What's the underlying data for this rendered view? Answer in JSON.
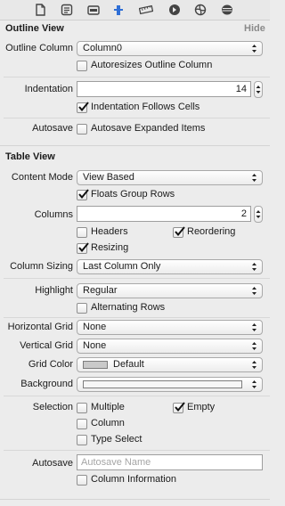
{
  "toolbar": {
    "icons": [
      "file-inspector-icon",
      "quick-help-icon",
      "identity-inspector-icon",
      "attributes-inspector-icon",
      "size-inspector-icon",
      "connections-inspector-icon",
      "bindings-inspector-icon",
      "view-effects-inspector-icon"
    ],
    "selected": "attributes-inspector-icon"
  },
  "outline_view": {
    "title": "Outline View",
    "hide": "Hide",
    "outline_column_label": "Outline Column",
    "outline_column_value": "Column0",
    "autoresizes_label": "Autoresizes Outline Column",
    "autoresizes_checked": false,
    "indentation_label": "Indentation",
    "indentation_value": "14",
    "indent_follows_label": "Indentation Follows Cells",
    "indent_follows_checked": true,
    "autosave_label": "Autosave",
    "autosave_expanded_label": "Autosave Expanded Items",
    "autosave_expanded_checked": false
  },
  "table_view": {
    "title": "Table View",
    "content_mode_label": "Content Mode",
    "content_mode_value": "View Based",
    "floats_group_rows_label": "Floats Group Rows",
    "floats_group_rows_checked": true,
    "columns_label": "Columns",
    "columns_value": "2",
    "headers_label": "Headers",
    "headers_checked": false,
    "reordering_label": "Reordering",
    "reordering_checked": true,
    "resizing_label": "Resizing",
    "resizing_checked": true,
    "column_sizing_label": "Column Sizing",
    "column_sizing_value": "Last Column Only",
    "highlight_label": "Highlight",
    "highlight_value": "Regular",
    "alternating_rows_label": "Alternating Rows",
    "alternating_rows_checked": false,
    "horizontal_grid_label": "Horizontal Grid",
    "horizontal_grid_value": "None",
    "vertical_grid_label": "Vertical Grid",
    "vertical_grid_value": "None",
    "grid_color_label": "Grid Color",
    "grid_color_value": "Default",
    "grid_color_swatch": "#c9c9c9",
    "background_label": "Background",
    "background_swatch": "#f6f6f6",
    "selection_label": "Selection",
    "multiple_label": "Multiple",
    "multiple_checked": false,
    "empty_label": "Empty",
    "empty_checked": true,
    "column_label": "Column",
    "column_checked": false,
    "type_select_label": "Type Select",
    "type_select_checked": false,
    "autosave_label": "Autosave",
    "autosave_placeholder": "Autosave Name",
    "column_information_label": "Column Information",
    "column_information_checked": false
  }
}
